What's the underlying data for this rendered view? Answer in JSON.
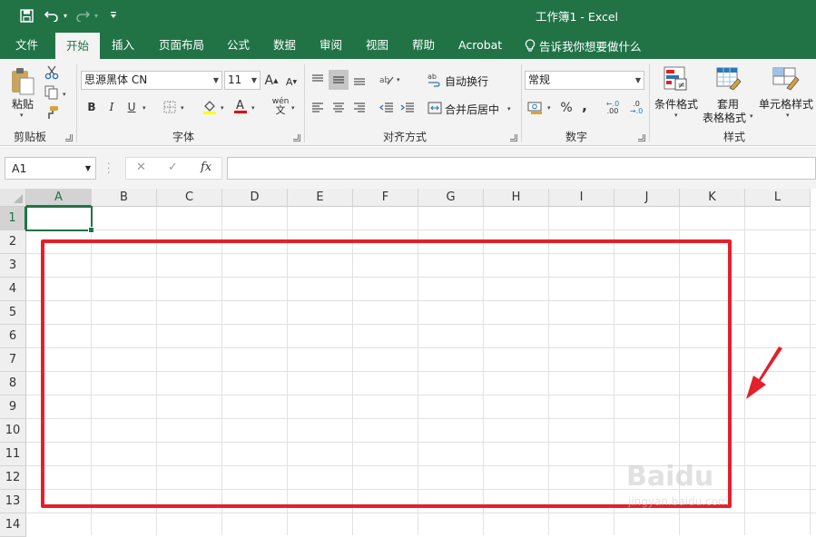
{
  "window": {
    "title": "工作簿1  -  Excel"
  },
  "colors": {
    "brand": "#217346",
    "annotation": "#e4202a"
  },
  "quick_access": [
    {
      "name": "save-icon"
    },
    {
      "name": "undo-icon"
    },
    {
      "name": "redo-icon"
    },
    {
      "name": "customize-icon"
    }
  ],
  "tabs": [
    {
      "label": "文件"
    },
    {
      "label": "开始",
      "active": true
    },
    {
      "label": "插入"
    },
    {
      "label": "页面布局"
    },
    {
      "label": "公式"
    },
    {
      "label": "数据"
    },
    {
      "label": "审阅"
    },
    {
      "label": "视图"
    },
    {
      "label": "帮助"
    },
    {
      "label": "Acrobat"
    }
  ],
  "tell_me": "告诉我你想要做什么",
  "ribbon": {
    "clipboard": {
      "label": "剪贴板",
      "paste": "粘贴"
    },
    "font": {
      "label": "字体",
      "font_name": "思源黑体 CN",
      "font_size": "11",
      "bold": "B",
      "italic": "I",
      "underline": "U",
      "phonetic": "wén"
    },
    "alignment": {
      "label": "对齐方式",
      "wrap_text": "自动换行",
      "merge_center": "合并后居中"
    },
    "number": {
      "label": "数字",
      "format": "常规",
      "percent": "%",
      "comma": ",",
      "inc_decimal": ".00",
      "dec_decimal": ".0"
    },
    "styles": {
      "label": "样式",
      "conditional": "条件格式",
      "table_format_1": "套用",
      "table_format_2": "表格格式",
      "cell_styles": "单元格样式"
    }
  },
  "formula_bar": {
    "name_box": "A1",
    "cancel": "✕",
    "enter": "✓",
    "fx": "fx",
    "value": ""
  },
  "grid": {
    "columns": [
      "A",
      "B",
      "C",
      "D",
      "E",
      "F",
      "G",
      "H",
      "I",
      "J",
      "K",
      "L"
    ],
    "rows": [
      "1",
      "2",
      "3",
      "4",
      "5",
      "6",
      "7",
      "8",
      "9",
      "10",
      "11",
      "12",
      "13",
      "14"
    ],
    "active_cell": "A1"
  },
  "watermark": {
    "brand": "Baidu",
    "sub": "jingyan.baidu.com"
  }
}
